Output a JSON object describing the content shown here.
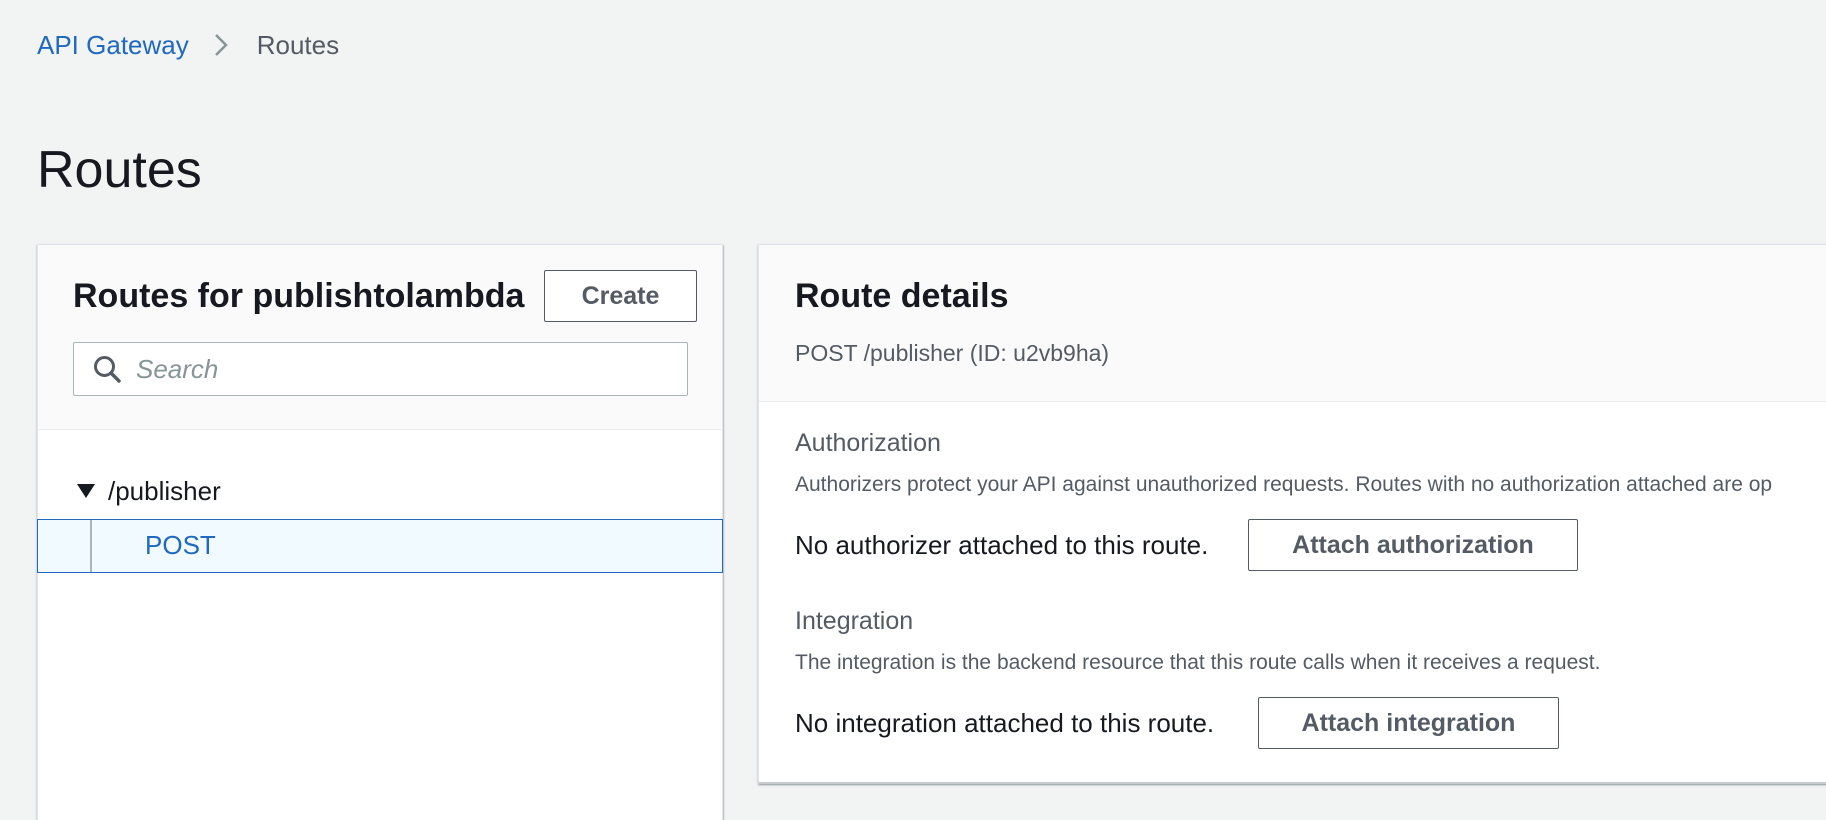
{
  "breadcrumb": {
    "parent": "API Gateway",
    "current": "Routes"
  },
  "page": {
    "title": "Routes"
  },
  "routes_panel": {
    "title": "Routes for publishtolambda",
    "create_label": "Create",
    "search_placeholder": "Search",
    "search_value": "",
    "tree": {
      "resource": "/publisher",
      "methods": [
        "POST"
      ]
    }
  },
  "details_panel": {
    "title": "Route details",
    "subtitle": "POST /publisher (ID: u2vb9ha)",
    "authorization": {
      "title": "Authorization",
      "description": "Authorizers protect your API against unauthorized requests. Routes with no authorization attached are op",
      "status": "No authorizer attached to this route.",
      "button_label": "Attach authorization"
    },
    "integration": {
      "title": "Integration",
      "description": "The integration is the backend resource that this route calls when it receives a request.",
      "status": "No integration attached to this route.",
      "button_label": "Attach integration"
    }
  },
  "colors": {
    "link": "#1f69c1",
    "background": "#f2f3f3",
    "selected_row": "#f1faff",
    "text_primary": "#16191f",
    "text_secondary": "#545b64"
  },
  "icons": {
    "breadcrumb_separator": "chevron-right-icon",
    "search": "search-icon",
    "tree_toggle": "caret-down-icon"
  }
}
